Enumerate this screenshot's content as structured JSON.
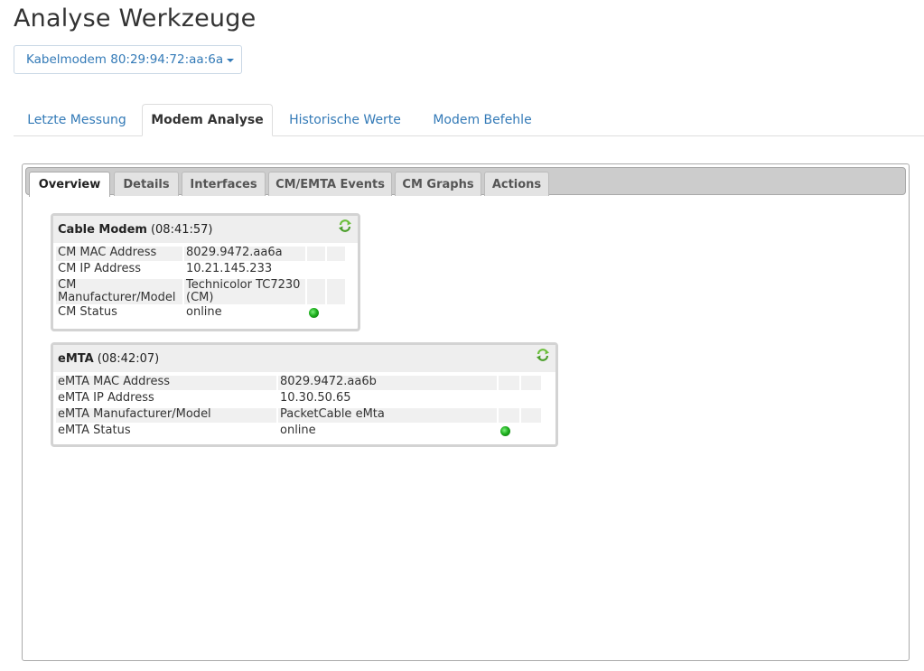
{
  "page": {
    "title": "Analyse Werkzeuge"
  },
  "device_selector": {
    "label": "Kabelmodem 80:29:94:72:aa:6a"
  },
  "main_tabs": [
    {
      "label": "Letzte Messung"
    },
    {
      "label": "Modem Analyse",
      "active": true
    },
    {
      "label": "Historische Werte"
    },
    {
      "label": "Modem Befehle"
    }
  ],
  "sub_tabs": [
    {
      "label": "Overview",
      "active": true
    },
    {
      "label": "Details"
    },
    {
      "label": "Interfaces"
    },
    {
      "label": "CM/EMTA Events"
    },
    {
      "label": "CM Graphs"
    },
    {
      "label": "Actions"
    }
  ],
  "cable_modem": {
    "title": "Cable Modem",
    "time": "(08:41:57)",
    "rows": [
      {
        "label": "CM MAC Address",
        "value": "8029.9472.aa6a"
      },
      {
        "label": "CM IP Address",
        "value": "10.21.145.233"
      },
      {
        "label": "CM Manufacturer/Model",
        "value": "Technicolor TC7230 (CM)"
      },
      {
        "label": "CM Status",
        "value": "online",
        "status_color": "#1fb01f"
      }
    ]
  },
  "emta": {
    "title": "eMTA",
    "time": "(08:42:07)",
    "rows": [
      {
        "label": "eMTA MAC Address",
        "value": "8029.9472.aa6b"
      },
      {
        "label": "eMTA IP Address",
        "value": "10.30.50.65"
      },
      {
        "label": "eMTA Manufacturer/Model",
        "value": "PacketCable eMta"
      },
      {
        "label": "eMTA Status",
        "value": "online",
        "status_color": "#1fb01f"
      }
    ]
  },
  "icons": {
    "refresh": "refresh-icon",
    "status": "status-led-icon"
  },
  "colors": {
    "link": "#337ab7",
    "status_online": "#1fb01f"
  }
}
